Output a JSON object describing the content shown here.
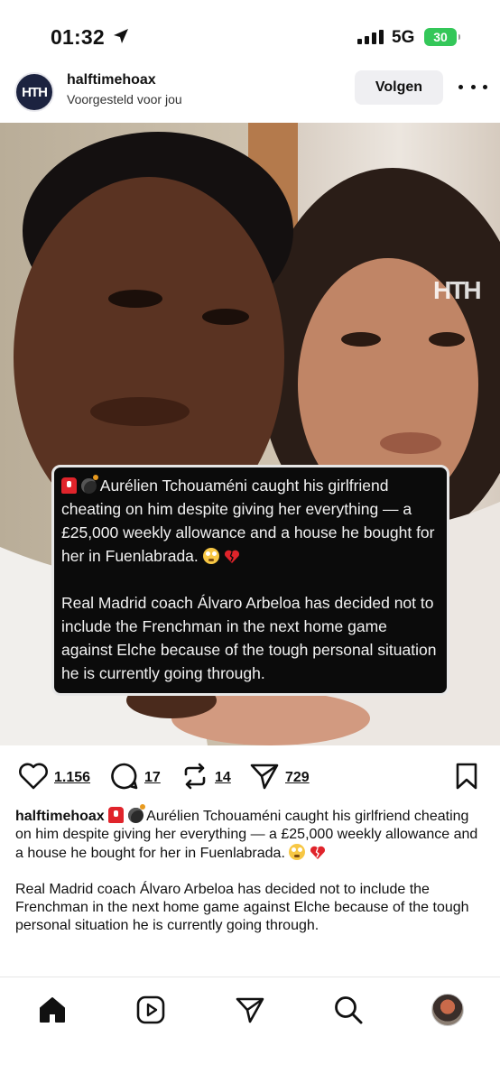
{
  "status_bar": {
    "time": "01:32",
    "network": "5G",
    "battery": "30"
  },
  "post": {
    "username": "halftimehoax",
    "subtitle": "Voorgesteld voor jou",
    "follow_label": "Volgen",
    "avatar_text": "HTH",
    "watermark": "HTH",
    "image_caption": {
      "paragraph1": "Aurélien Tchouaméni caught his girlfriend cheating on him despite giving her everything — a £25,000 weekly allowance and a house he bought for her in Fuenlabrada.",
      "paragraph2": "Real Madrid coach Álvaro Arbeloa has decided not to include the Frenchman in the next home game against Elche because of the tough personal situation he is currently going through."
    },
    "actions": {
      "likes": "1.156",
      "comments": "17",
      "reposts": "14",
      "shares": "729"
    },
    "caption": {
      "username": "halftimehoax",
      "paragraph1": "Aurélien Tchouaméni caught his girlfriend cheating on him despite giving her everything — a £25,000 weekly allowance and a house he bought for her in Fuenlabrada.",
      "paragraph2": "Real Madrid coach Álvaro Arbeloa has decided not to include the Frenchman in the next home game against Elche because of the tough personal situation he is currently going through."
    }
  },
  "icons": {
    "emoji_1": "police-light-emoji",
    "emoji_2": "bomb-emoji",
    "emoji_3": "flushed-face-emoji",
    "emoji_4": "broken-heart-emoji"
  },
  "bottom_nav": [
    "home",
    "reels",
    "messages",
    "search",
    "profile"
  ]
}
